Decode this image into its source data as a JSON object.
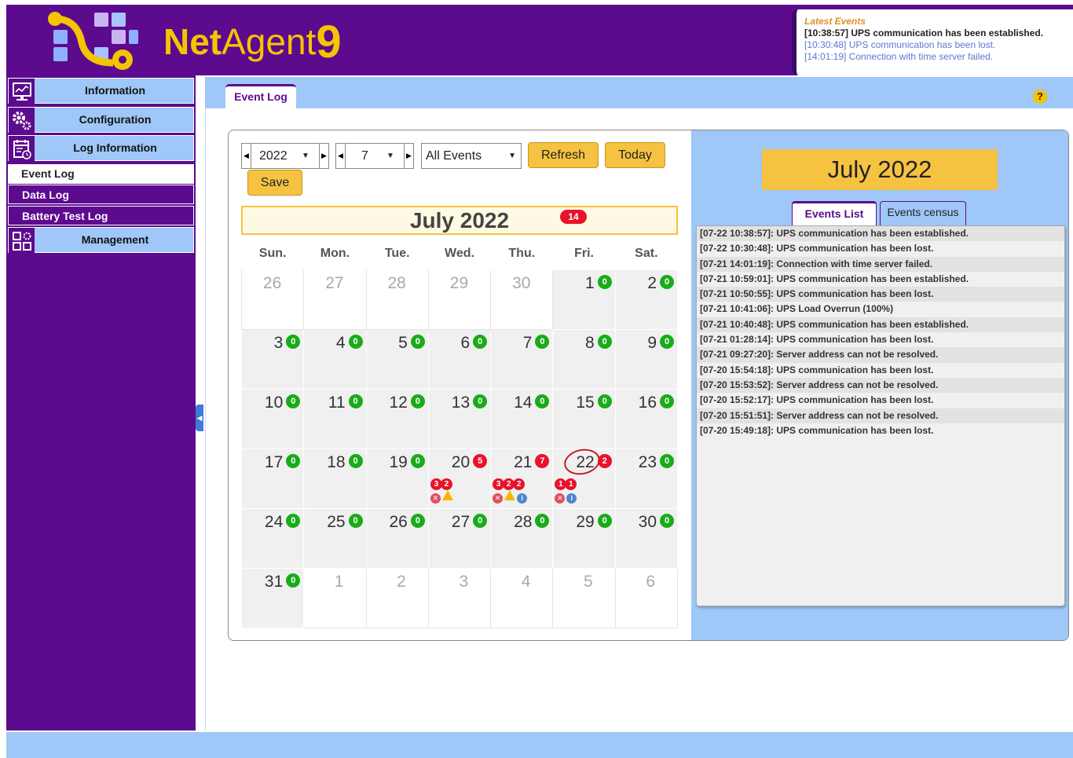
{
  "brand": {
    "part1": "Net",
    "part2": "Agent",
    "part3": "9"
  },
  "latest_events": {
    "title": "Latest Events",
    "items": [
      "[10:38:57] UPS communication has been established.",
      "[10:30:48] UPS communication has been lost.",
      "[14:01:19] Connection with time server failed."
    ]
  },
  "sidebar": {
    "information": "Information",
    "configuration": "Configuration",
    "log_information": "Log Information",
    "event_log": "Event Log",
    "data_log": "Data Log",
    "battery_test_log": "Battery Test Log",
    "management": "Management"
  },
  "page_tab": "Event Log",
  "help": "?",
  "controls": {
    "year": "2022",
    "month": "7",
    "filter": "All Events",
    "refresh": "Refresh",
    "today": "Today",
    "save": "Save"
  },
  "calendar": {
    "title": "July 2022",
    "total_count": "14",
    "weekdays": [
      "Sun.",
      "Mon.",
      "Tue.",
      "Wed.",
      "Thu.",
      "Fri.",
      "Sat."
    ],
    "weeks": [
      [
        {
          "d": "26",
          "out": true
        },
        {
          "d": "27",
          "out": true
        },
        {
          "d": "28",
          "out": true
        },
        {
          "d": "29",
          "out": true
        },
        {
          "d": "30",
          "out": true
        },
        {
          "d": "1",
          "c": "0"
        },
        {
          "d": "2",
          "c": "0"
        }
      ],
      [
        {
          "d": "3",
          "c": "0"
        },
        {
          "d": "4",
          "c": "0"
        },
        {
          "d": "5",
          "c": "0"
        },
        {
          "d": "6",
          "c": "0"
        },
        {
          "d": "7",
          "c": "0"
        },
        {
          "d": "8",
          "c": "0"
        },
        {
          "d": "9",
          "c": "0"
        }
      ],
      [
        {
          "d": "10",
          "c": "0"
        },
        {
          "d": "11",
          "c": "0"
        },
        {
          "d": "12",
          "c": "0"
        },
        {
          "d": "13",
          "c": "0"
        },
        {
          "d": "14",
          "c": "0"
        },
        {
          "d": "15",
          "c": "0"
        },
        {
          "d": "16",
          "c": "0"
        }
      ],
      [
        {
          "d": "17",
          "c": "0"
        },
        {
          "d": "18",
          "c": "0"
        },
        {
          "d": "19",
          "c": "0"
        },
        {
          "d": "20",
          "c": "5",
          "red": true,
          "subs": [
            "3",
            "2"
          ],
          "icons": [
            "error",
            "warning"
          ]
        },
        {
          "d": "21",
          "c": "7",
          "red": true,
          "subs": [
            "3",
            "2",
            "2"
          ],
          "icons": [
            "error",
            "warning",
            "info"
          ]
        },
        {
          "d": "22",
          "c": "2",
          "red": true,
          "today": true,
          "subs": [
            "1",
            "1"
          ],
          "icons": [
            "error",
            "info"
          ]
        },
        {
          "d": "23",
          "c": "0"
        }
      ],
      [
        {
          "d": "24",
          "c": "0"
        },
        {
          "d": "25",
          "c": "0"
        },
        {
          "d": "26",
          "c": "0"
        },
        {
          "d": "27",
          "c": "0"
        },
        {
          "d": "28",
          "c": "0"
        },
        {
          "d": "29",
          "c": "0"
        },
        {
          "d": "30",
          "c": "0"
        }
      ],
      [
        {
          "d": "31",
          "c": "0"
        },
        {
          "d": "1",
          "out": true
        },
        {
          "d": "2",
          "out": true
        },
        {
          "d": "3",
          "out": true
        },
        {
          "d": "4",
          "out": true
        },
        {
          "d": "5",
          "out": true
        },
        {
          "d": "6",
          "out": true
        }
      ]
    ]
  },
  "right_panel": {
    "month_title": "July 2022",
    "tab_list": "Events List",
    "tab_census": "Events census",
    "events": [
      "[07-22 10:38:57]: UPS communication has been established.",
      "[07-22 10:30:48]: UPS communication has been lost.",
      "[07-21 14:01:19]: Connection with time server failed.",
      "[07-21 10:59:01]: UPS communication has been established.",
      "[07-21 10:50:55]: UPS communication has been lost.",
      "[07-21 10:41:06]: UPS Load Overrun (100%)",
      "[07-21 10:40:48]: UPS communication has been established.",
      "[07-21 01:28:14]: UPS communication has been lost.",
      "[07-21 09:27:20]: Server address can not be resolved.",
      "[07-20 15:54:18]: UPS communication has been lost.",
      "[07-20 15:53:52]: Server address can not be resolved.",
      "[07-20 15:52:17]: UPS communication has been lost.",
      "[07-20 15:51:51]: Server address can not be resolved.",
      "[07-20 15:49:18]: UPS communication has been lost."
    ]
  },
  "colors": {
    "purple": "#5c0a8e",
    "light_blue": "#9fc7f7",
    "gold": "#f5c242",
    "red_badge": "#e8132b",
    "green_badge": "#1aab1a"
  }
}
